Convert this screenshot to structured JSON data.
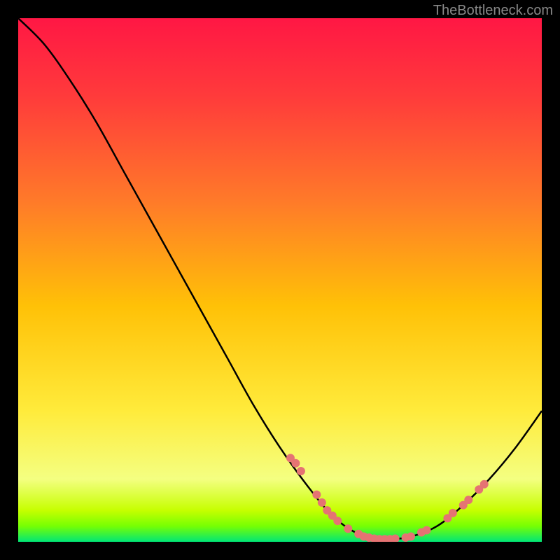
{
  "watermark": "TheBottleneck.com",
  "chart_data": {
    "type": "line",
    "title": "",
    "xlabel": "",
    "ylabel": "",
    "xlim": [
      0,
      100
    ],
    "ylim": [
      0,
      100
    ],
    "curve": [
      {
        "x": 0,
        "y": 100
      },
      {
        "x": 5,
        "y": 95
      },
      {
        "x": 10,
        "y": 88
      },
      {
        "x": 15,
        "y": 80
      },
      {
        "x": 20,
        "y": 71
      },
      {
        "x": 25,
        "y": 62
      },
      {
        "x": 30,
        "y": 53
      },
      {
        "x": 35,
        "y": 44
      },
      {
        "x": 40,
        "y": 35
      },
      {
        "x": 45,
        "y": 26
      },
      {
        "x": 50,
        "y": 18
      },
      {
        "x": 55,
        "y": 11
      },
      {
        "x": 60,
        "y": 5
      },
      {
        "x": 65,
        "y": 1.5
      },
      {
        "x": 70,
        "y": 0.5
      },
      {
        "x": 75,
        "y": 1
      },
      {
        "x": 80,
        "y": 3
      },
      {
        "x": 85,
        "y": 7
      },
      {
        "x": 90,
        "y": 12
      },
      {
        "x": 95,
        "y": 18
      },
      {
        "x": 100,
        "y": 25
      }
    ],
    "markers": [
      {
        "x": 52,
        "y": 16
      },
      {
        "x": 53,
        "y": 15
      },
      {
        "x": 54,
        "y": 13.5
      },
      {
        "x": 57,
        "y": 9
      },
      {
        "x": 58,
        "y": 7.5
      },
      {
        "x": 59,
        "y": 6
      },
      {
        "x": 60,
        "y": 5
      },
      {
        "x": 61,
        "y": 4
      },
      {
        "x": 63,
        "y": 2.5
      },
      {
        "x": 65,
        "y": 1.5
      },
      {
        "x": 66,
        "y": 1
      },
      {
        "x": 67,
        "y": 0.8
      },
      {
        "x": 68,
        "y": 0.6
      },
      {
        "x": 69,
        "y": 0.5
      },
      {
        "x": 70,
        "y": 0.5
      },
      {
        "x": 71,
        "y": 0.5
      },
      {
        "x": 72,
        "y": 0.6
      },
      {
        "x": 74,
        "y": 0.8
      },
      {
        "x": 75,
        "y": 1
      },
      {
        "x": 77,
        "y": 1.8
      },
      {
        "x": 78,
        "y": 2.2
      },
      {
        "x": 82,
        "y": 4.5
      },
      {
        "x": 83,
        "y": 5.5
      },
      {
        "x": 85,
        "y": 7
      },
      {
        "x": 86,
        "y": 8
      },
      {
        "x": 88,
        "y": 10
      },
      {
        "x": 89,
        "y": 11
      }
    ],
    "gradient_stops": [
      {
        "offset": 0,
        "color": "#ff1744"
      },
      {
        "offset": 0.15,
        "color": "#ff3b3b"
      },
      {
        "offset": 0.35,
        "color": "#ff7a29"
      },
      {
        "offset": 0.55,
        "color": "#ffc107"
      },
      {
        "offset": 0.75,
        "color": "#ffeb3b"
      },
      {
        "offset": 0.88,
        "color": "#f4ff81"
      },
      {
        "offset": 0.94,
        "color": "#c6ff00"
      },
      {
        "offset": 0.97,
        "color": "#76ff03"
      },
      {
        "offset": 1.0,
        "color": "#00e676"
      }
    ],
    "marker_color": "#e57373"
  }
}
